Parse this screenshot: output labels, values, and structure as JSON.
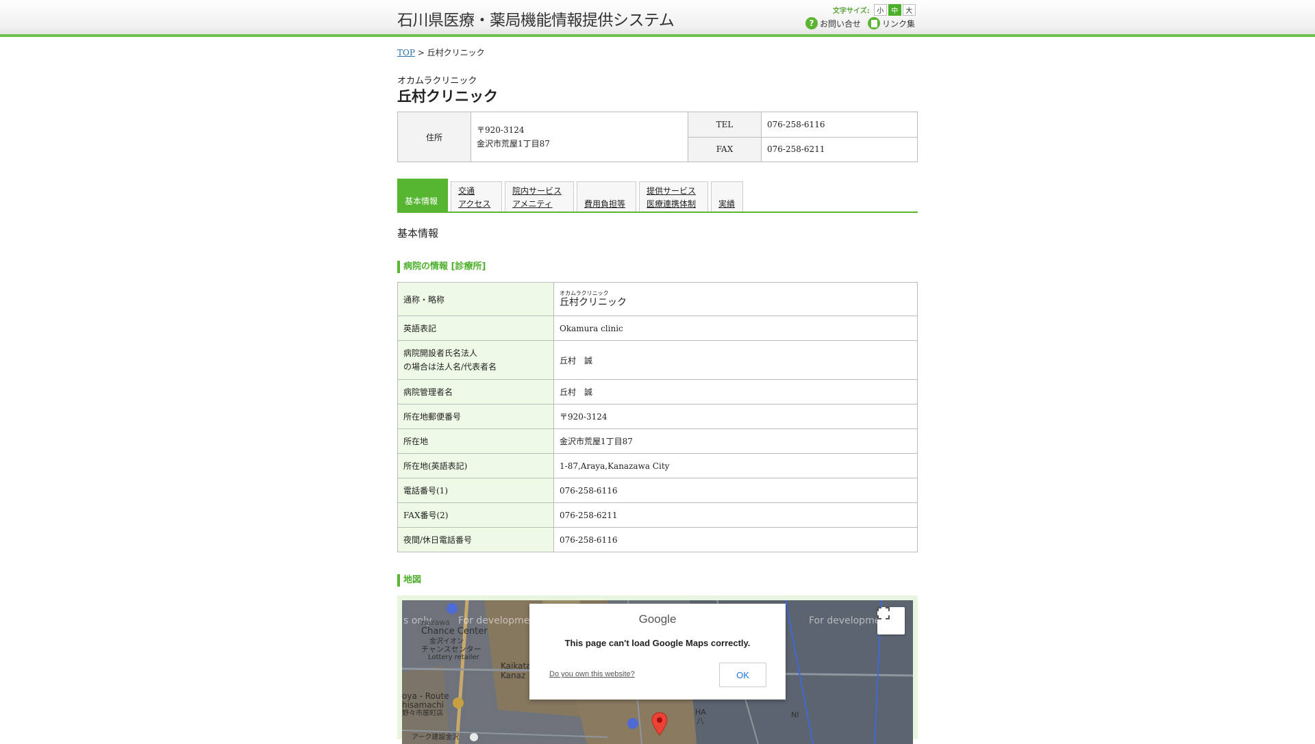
{
  "header": {
    "site_title": "石川県医療・薬局機能情報提供システム",
    "font_size_label": "文字サイズ:",
    "font_sizes": [
      "小",
      "中",
      "大"
    ],
    "font_size_selected": "中",
    "contact_label": "お問い合せ",
    "links_label": "リンク集"
  },
  "breadcrumb": {
    "top": "TOP",
    "separator": ">",
    "current": "丘村クリニック"
  },
  "facility": {
    "name_kana": "オカムラクリニック",
    "name": "丘村クリニック"
  },
  "summary": {
    "address_label": "住所",
    "postal": "〒920-3124",
    "address": "金沢市荒屋1丁目87",
    "tel_label": "TEL",
    "tel": "076-258-6116",
    "fax_label": "FAX",
    "fax": "076-258-6211"
  },
  "tabs": [
    {
      "line1": "",
      "line2": "基本情報"
    },
    {
      "line1": "交通",
      "line2": "アクセス"
    },
    {
      "line1": "院内サービス",
      "line2": "アメニティ"
    },
    {
      "line1": "",
      "line2": "費用負担等"
    },
    {
      "line1": "提供サービス",
      "line2": "医療連携体制"
    },
    {
      "line1": "",
      "line2": "実績"
    }
  ],
  "section_title": "基本情報",
  "hospital_info": {
    "heading": "病院の情報 [診療所]",
    "rows": [
      {
        "key": "通称・略称",
        "ruby": "オカムラクリニック",
        "value": "丘村クリニック"
      },
      {
        "key": "英語表記",
        "value": "Okamura clinic"
      },
      {
        "key_line1": "病院開設者氏名法人",
        "key_line2": "の場合は法人名/代表者名",
        "value": "丘村　誠"
      },
      {
        "key": "病院管理者名",
        "value": "丘村　誠"
      },
      {
        "key": "所在地郵便番号",
        "value": "〒920-3124"
      },
      {
        "key": "所在地",
        "value": "金沢市荒屋1丁目87"
      },
      {
        "key": "所在地(英語表記)",
        "value": "1-87,Araya,Kanazawa City"
      },
      {
        "key": "電話番号(1)",
        "value": "076-258-6116"
      },
      {
        "key": "FAX番号(2)",
        "value": "076-258-6211"
      },
      {
        "key": "夜間/休日電話番号",
        "value": "076-258-6116"
      }
    ]
  },
  "map": {
    "heading": "地図",
    "dev_watermark": "For development purposes only",
    "labels": {
      "chance_en": "Chance Center",
      "chance_jp": "チャンスセンター",
      "chance_jp2": "金沢イオン",
      "lottery": "Lottery retailer",
      "kanazawa_partial": "nazawa",
      "kaikata": "Kaikata",
      "kanaz": "Kanaz",
      "route": "oya - Route",
      "shisa": "hisamachi",
      "jp_shop": "野々市屋町店",
      "ha": "HA",
      "ni": "NI",
      "ha_jp": "八",
      "bottom_jp": "アーク建設金沢"
    },
    "dialog": {
      "logo": "Google",
      "message": "This page can't load Google Maps correctly.",
      "own_link": "Do you own this website?",
      "ok": "OK"
    },
    "icons": [
      "map-marker-icon",
      "fullscreen-icon",
      "restaurant-icon",
      "atm-icon"
    ]
  },
  "colors": {
    "accent": "#5bb533",
    "label_bg": "#eef9e6",
    "link": "#2a6fb0"
  }
}
